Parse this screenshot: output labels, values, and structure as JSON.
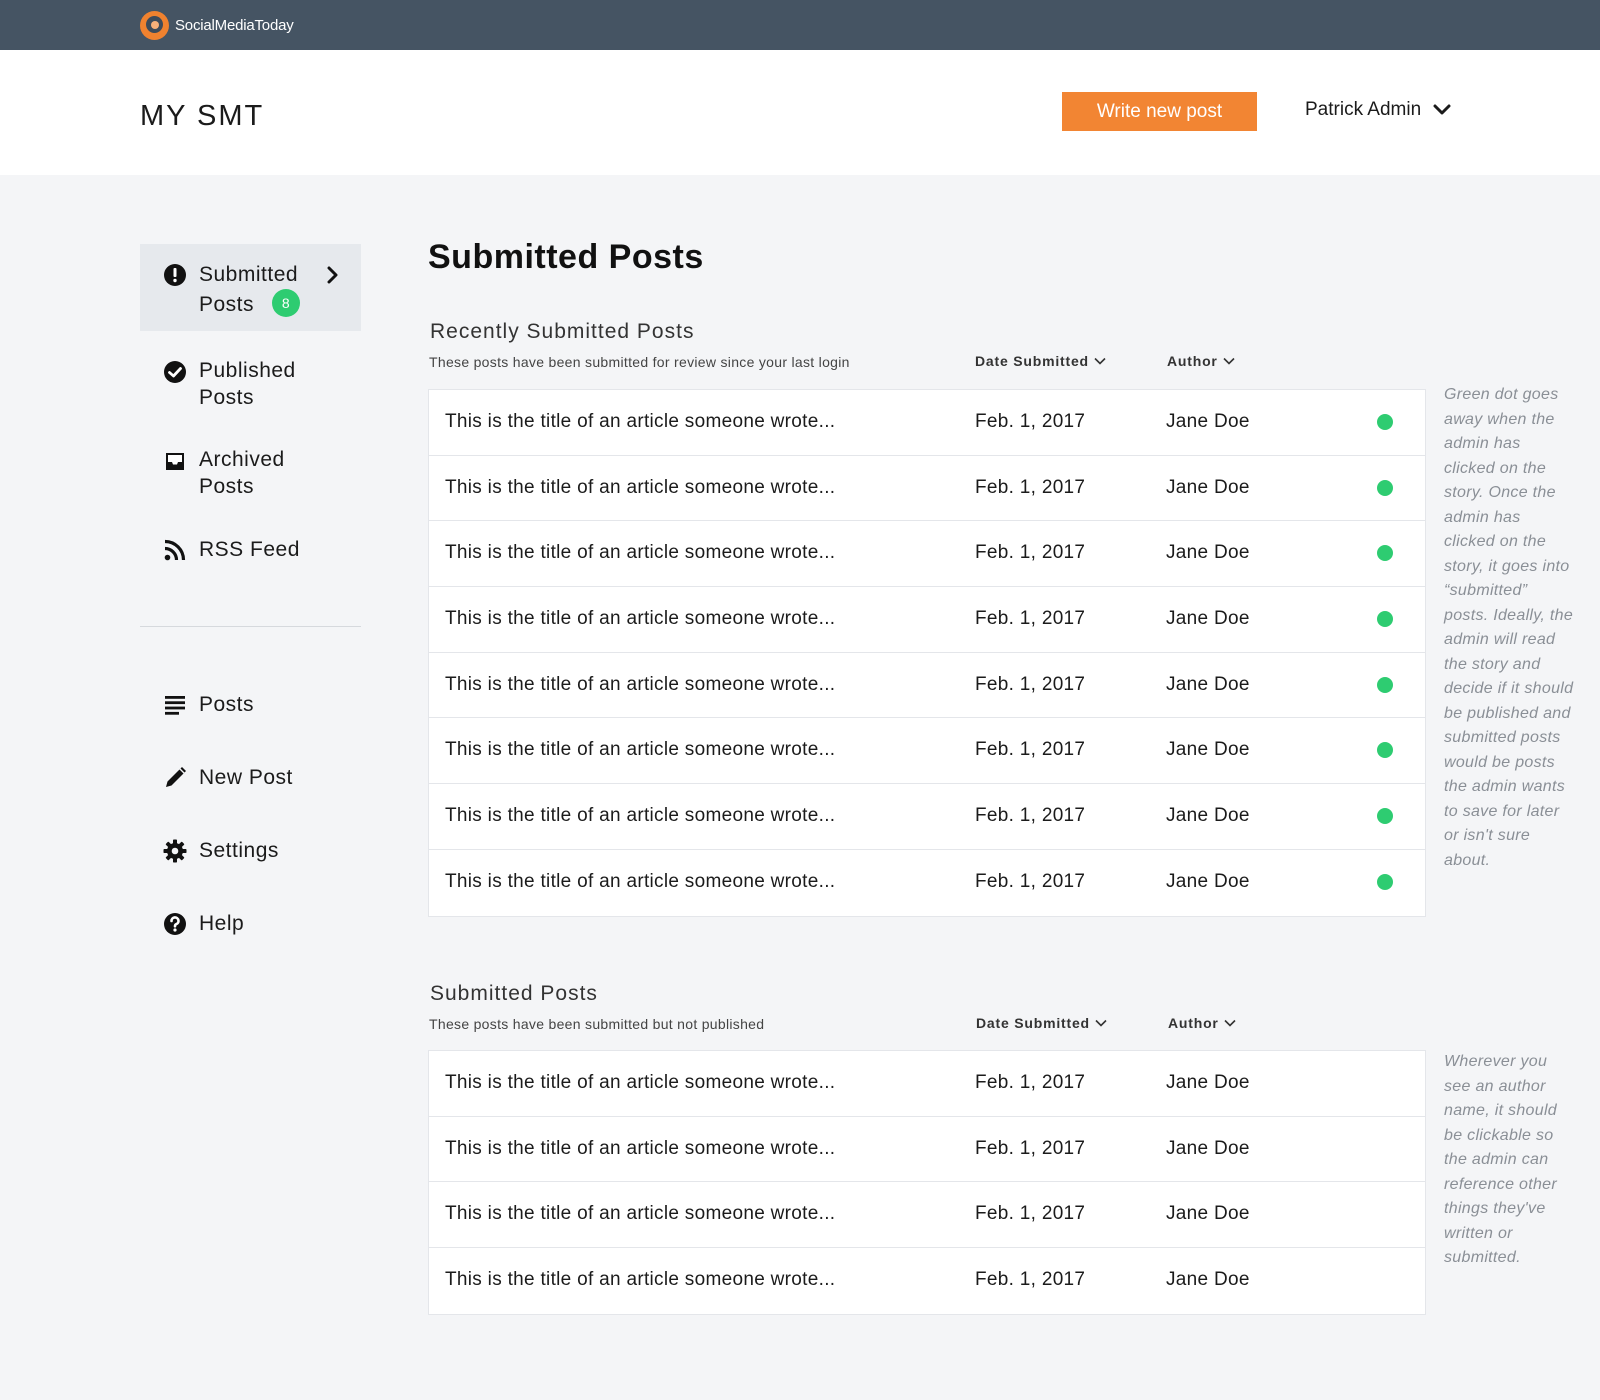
{
  "topbar": {
    "brand_name": "SocialMediaToday"
  },
  "header": {
    "page_brand": "MY SMT",
    "write_button": "Write new post",
    "user_name": "Patrick Admin"
  },
  "sidebar": {
    "primary": [
      {
        "label_line1": "Submitted",
        "label_line2": "Posts",
        "badge": "8",
        "icon": "exclamation-circle-icon",
        "active": true
      },
      {
        "label_line1": "Published",
        "label_line2": "Posts",
        "icon": "check-circle-icon"
      },
      {
        "label_line1": "Archived",
        "label_line2": "Posts",
        "icon": "inbox-icon"
      },
      {
        "label_line1": "RSS Feed",
        "icon": "rss-icon"
      }
    ],
    "secondary": [
      {
        "label": "Posts",
        "icon": "list-icon"
      },
      {
        "label": "New Post",
        "icon": "pencil-icon"
      },
      {
        "label": "Settings",
        "icon": "gear-icon"
      },
      {
        "label": "Help",
        "icon": "question-circle-icon"
      }
    ]
  },
  "main": {
    "title": "Submitted Posts",
    "recent": {
      "title": "Recently Submitted Posts",
      "subtitle": "These posts have been submitted for review since your last login",
      "col_date": "Date Submitted",
      "col_author": "Author",
      "rows": [
        {
          "title": "This is the title of an article someone wrote...",
          "date": "Feb. 1, 2017",
          "author": "Jane Doe",
          "unread": true
        },
        {
          "title": "This is the title of an article someone wrote...",
          "date": "Feb. 1, 2017",
          "author": "Jane Doe",
          "unread": true
        },
        {
          "title": "This is the title of an article someone wrote...",
          "date": "Feb. 1, 2017",
          "author": "Jane Doe",
          "unread": true
        },
        {
          "title": "This is the title of an article someone wrote...",
          "date": "Feb. 1, 2017",
          "author": "Jane Doe",
          "unread": true
        },
        {
          "title": "This is the title of an article someone wrote...",
          "date": "Feb. 1, 2017",
          "author": "Jane Doe",
          "unread": true
        },
        {
          "title": "This is the title of an article someone wrote...",
          "date": "Feb. 1, 2017",
          "author": "Jane Doe",
          "unread": true
        },
        {
          "title": "This is the title of an article someone wrote...",
          "date": "Feb. 1, 2017",
          "author": "Jane Doe",
          "unread": true
        },
        {
          "title": "This is the title of an article someone wrote...",
          "date": "Feb. 1, 2017",
          "author": "Jane Doe",
          "unread": true
        }
      ],
      "note": "Green dot goes away when the admin has clicked on the story. Once the admin has clicked on the story, it goes into “submitted” posts. Ideally, the admin will read the story and decide if it should be published and submitted posts would be posts the admin wants to save for later or isn't sure about."
    },
    "submitted": {
      "title": "Submitted Posts",
      "subtitle": "These posts have been submitted but not published",
      "col_date": "Date Submitted",
      "col_author": "Author",
      "rows": [
        {
          "title": "This is the title of an article someone wrote...",
          "date": "Feb. 1, 2017",
          "author": "Jane Doe",
          "unread": false
        },
        {
          "title": "This is the title of an article someone wrote...",
          "date": "Feb. 1, 2017",
          "author": "Jane Doe",
          "unread": false
        },
        {
          "title": "This is the title of an article someone wrote...",
          "date": "Feb. 1, 2017",
          "author": "Jane Doe",
          "unread": false
        },
        {
          "title": "This is the title of an article someone wrote...",
          "date": "Feb. 1, 2017",
          "author": "Jane Doe",
          "unread": false
        }
      ],
      "note": "Wherever you see an author name, it should be clickable so the admin can reference other things they've written or submitted."
    }
  },
  "colors": {
    "topbar": "#455463",
    "accent": "#f28533",
    "unread_dot": "#2ecc71",
    "background": "#f4f5f7"
  }
}
